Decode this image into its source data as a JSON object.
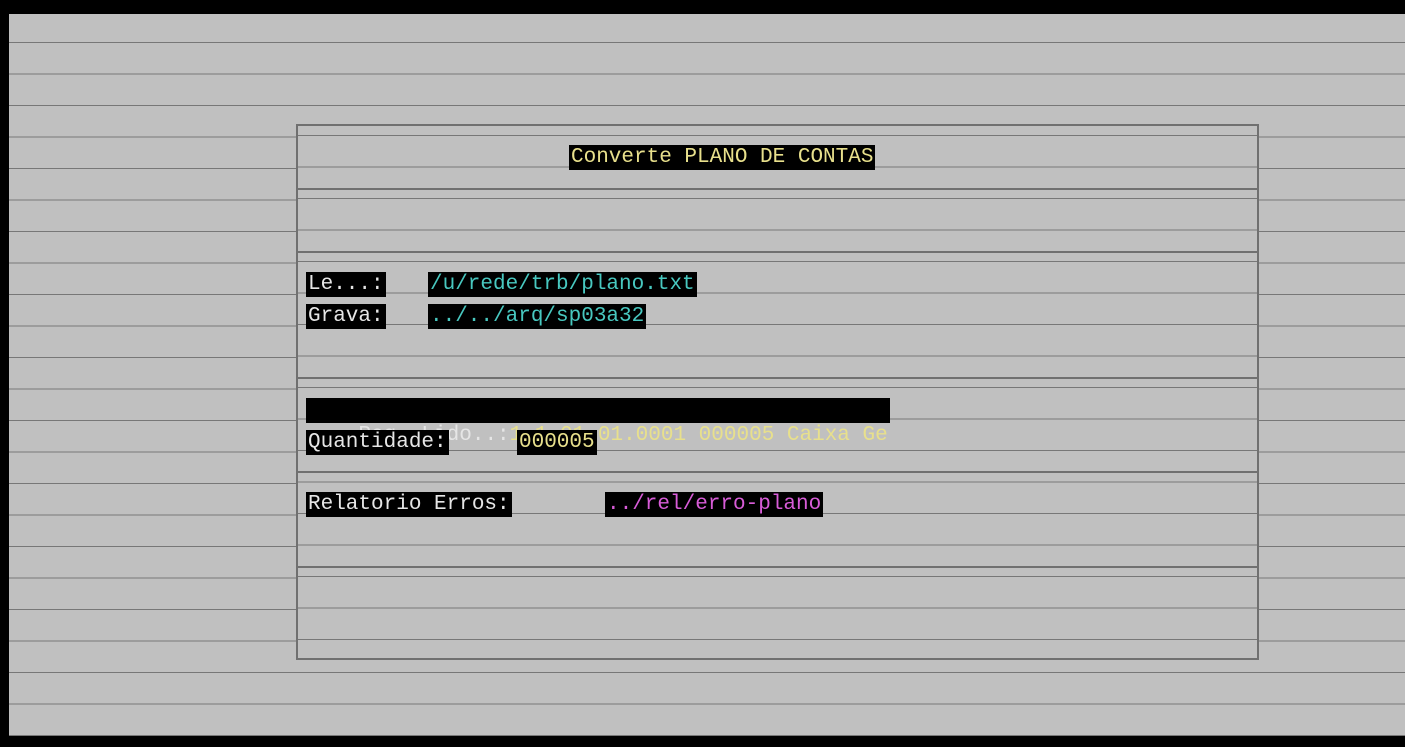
{
  "dialog": {
    "title": "Converte PLANO DE CONTAS",
    "le_label": "Le...:",
    "le_value": "/u/rede/trb/plano.txt",
    "grava_label": "Grava:",
    "grava_value": "../../arq/sp03a32",
    "reg_lido_label": "Reg. Lido..:",
    "reg_lido_value": "1.1.01.01.0001 000005 Caixa Ge",
    "quantidade_label": "Quantidade:",
    "quantidade_value": "000005",
    "relatorio_label": "Relatorio Erros:",
    "relatorio_value": "../rel/erro-plano"
  },
  "colors": {
    "background": "#c0c0c0",
    "label": "#e6e6e6",
    "title": "#e8e08c",
    "path": "#48c8c0",
    "error_path": "#d85cd8"
  }
}
